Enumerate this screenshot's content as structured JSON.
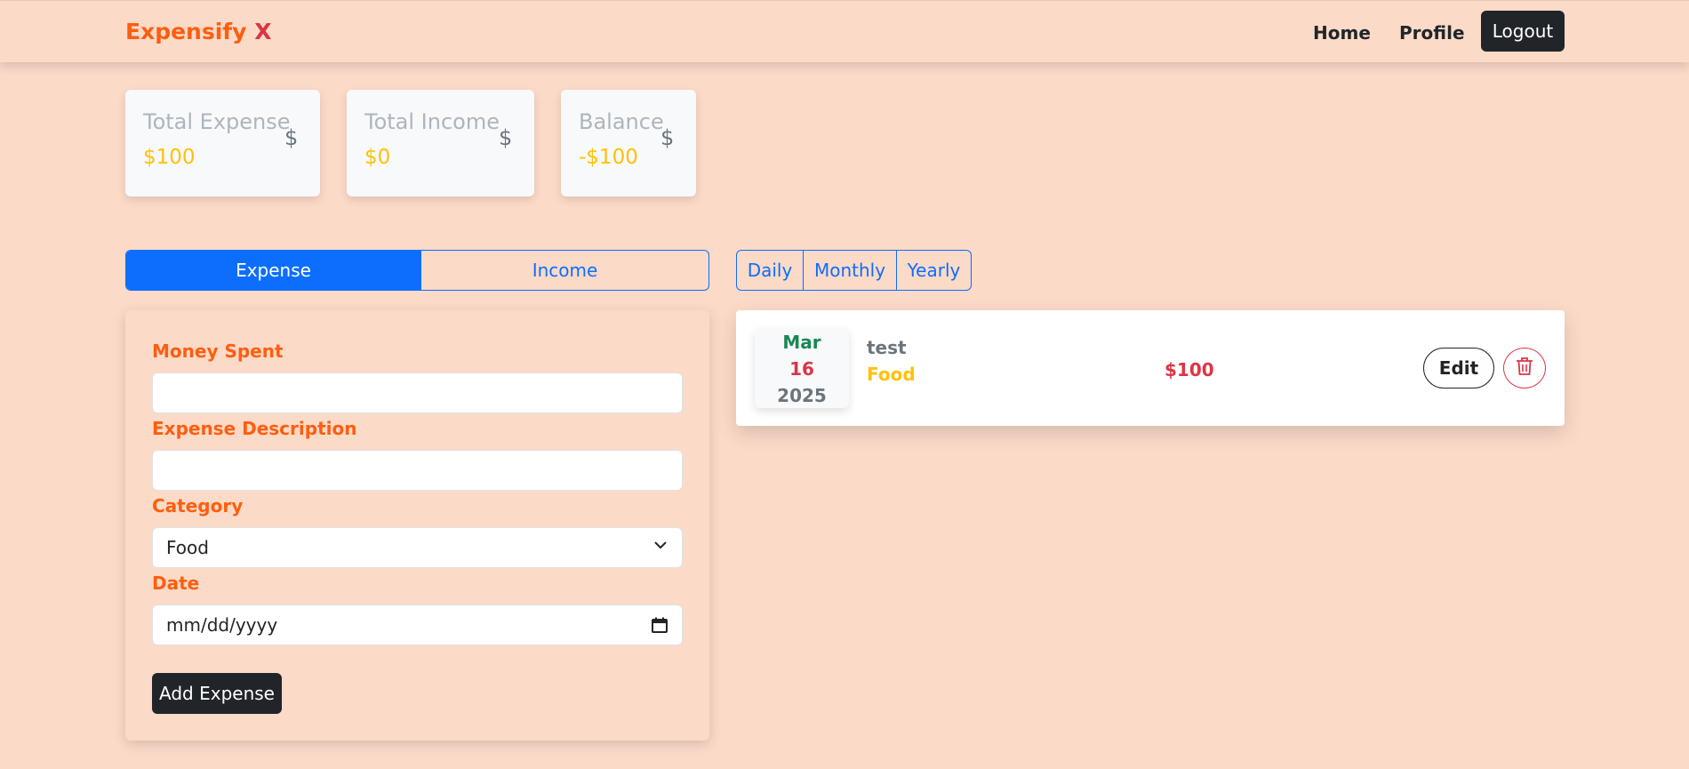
{
  "navbar": {
    "brand": "Expensify",
    "brand_x": "X",
    "links": [
      "Home",
      "Profile"
    ],
    "logout": "Logout"
  },
  "stats": [
    {
      "label": "Total Expense",
      "value": "$100",
      "icon": "$"
    },
    {
      "label": "Total Income",
      "value": "$0",
      "icon": "$"
    },
    {
      "label": "Balance",
      "value": "-$100",
      "icon": "$"
    }
  ],
  "toggle": {
    "active": "Expense",
    "inactive": "Income"
  },
  "periods": [
    "Daily",
    "Monthly",
    "Yearly"
  ],
  "form": {
    "money_label": "Money Spent",
    "money_value": "",
    "desc_label": "Expense Description",
    "desc_value": "",
    "category_label": "Category",
    "category_value": "Food",
    "date_label": "Date",
    "date_placeholder": "mm/dd/yyyy",
    "submit": "Add Expense"
  },
  "transactions": [
    {
      "month": "Mar",
      "day": "16",
      "year": "2025",
      "description": "test",
      "category": "Food",
      "amount": "$100",
      "edit": "Edit",
      "delete_icon": "trash-icon"
    }
  ],
  "colors": {
    "background": "#fcdac8",
    "brand": "#fd5e0f",
    "primary": "#0d6efd",
    "danger": "#dc3545",
    "warning": "#ffc107",
    "success": "#198754"
  }
}
